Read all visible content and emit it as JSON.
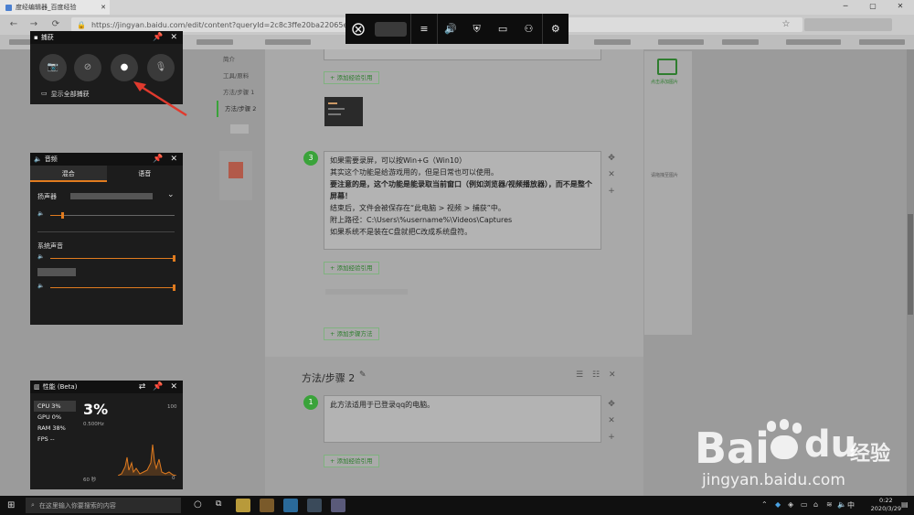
{
  "browser": {
    "tab_title": "度经编辑器_百度经验",
    "url": "https://jingyan.baidu.com/edit/content?queryId=2c8c3ffe20ba22065e3c2cb",
    "back_icon": "arrow-left",
    "forward_icon": "arrow-right",
    "reload_icon": "reload",
    "star_icon": "star"
  },
  "editor": {
    "left_nav": [
      "简介",
      "工具/原料",
      "方法/步骤 1",
      "方法/步骤 2"
    ],
    "step3_number": "3",
    "step3_lines": [
      "如果需要录屏，可以按Win+G（Win10）",
      "其实这个功能是给游戏用的，但是日常也可以使用。"
    ],
    "step3_bold": "要注意的是，这个功能是能录取当前窗口（例如浏览器/视频播放器），而不是整个屏幕！",
    "step3_lines2": [
      "结束后，文件会被保存在“此电脑 > 视频 > 捕获”中。",
      "附上路径：C:\\Users\\%username%\\Videos\\Captures",
      "如果系统不是装在C盘就把C改成系统盘符。"
    ],
    "add_ref": "+ 添加经验引用",
    "add_step_method": "+ 添加步骤方法",
    "section2_title": "方法/步骤 2",
    "step1_number": "1",
    "step1_text": "此方法适用于已登录qq的电脑。",
    "right_add_image": "点击添加图片",
    "right_hint": "请拖拽至图片"
  },
  "gamebar": {
    "icons": [
      "xbox-icon",
      "menu-icon",
      "volume-icon",
      "capture-icon",
      "monitor-icon",
      "social-icon",
      "settings-icon"
    ]
  },
  "capture_widget": {
    "title": "捕获",
    "show_all": "显示全部捕获"
  },
  "audio_widget": {
    "title": "音频",
    "tab_mix": "混合",
    "tab_voice": "语音",
    "speaker_label": "扬声器",
    "system_sound": "系统声音",
    "speaker_level": 0.1,
    "system_level": 1.0,
    "app_level": 1.0
  },
  "perf_widget": {
    "title": "性能 (Beta)",
    "metrics": [
      "CPU  3%",
      "GPU  0%",
      "RAM  38%",
      "FPS  --"
    ],
    "big_value": "3%",
    "freq": "0.500Hz",
    "scale_max": "100",
    "scale_min": "0",
    "time_label": "60 秒"
  },
  "taskbar": {
    "search_placeholder": "在这里输入你要搜索的内容",
    "ime": "中",
    "time": "0:22",
    "date": "2020/3/29"
  },
  "watermark": {
    "brand": "Bai",
    "brand2": "du",
    "jingyan": "经验",
    "url": "jingyan.baidu.com"
  }
}
